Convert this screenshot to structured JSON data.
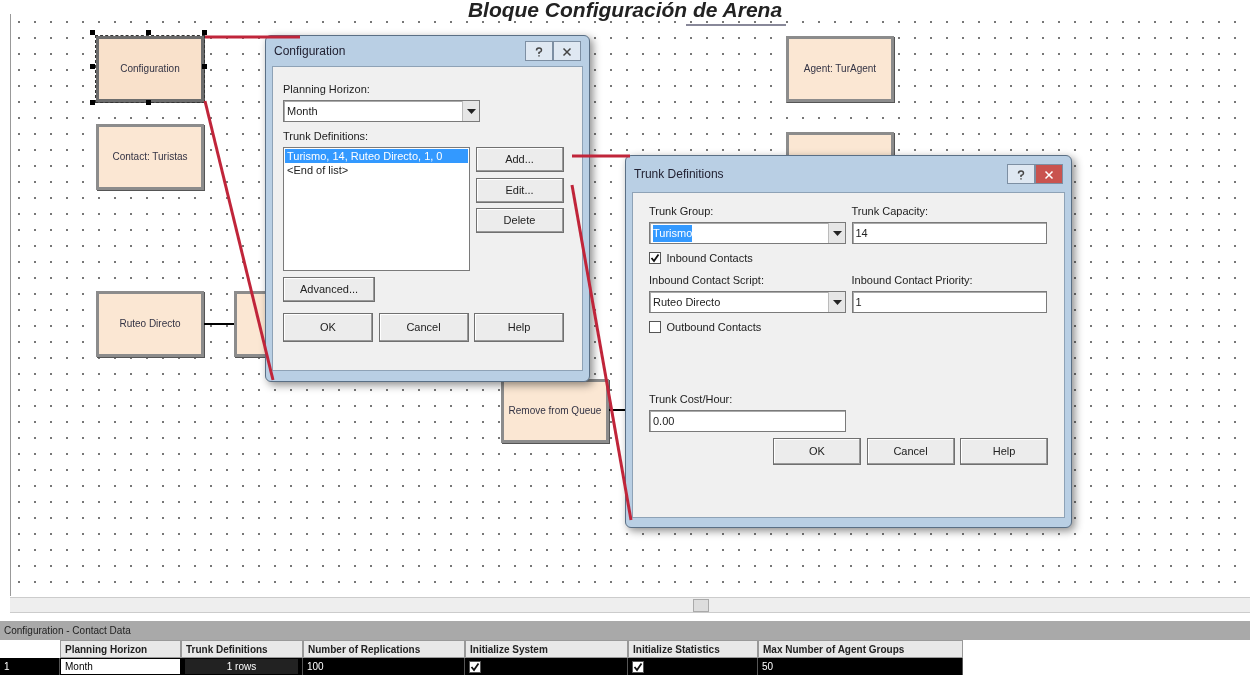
{
  "title": "Bloque Configuración de Arena",
  "modules": [
    {
      "label": "Configuration",
      "selected": true
    },
    {
      "label": "Contact: Turistas",
      "selected": false
    },
    {
      "label": "Ruteo Directo",
      "selected": false
    },
    {
      "label": "Agent: TurAgent",
      "selected": false
    },
    {
      "label": "Remove from Queue",
      "selected": false
    }
  ],
  "config_dialog": {
    "title": "Configuration",
    "planning_horizon_label": "Planning Horizon:",
    "planning_horizon": "Month",
    "trunk_definitions_label": "Trunk Definitions:",
    "trunk_definitions": [
      {
        "text": "Turismo, 14, Ruteo Directo, 1, 0",
        "selected": true
      },
      {
        "text": "<End of list>",
        "selected": false
      }
    ],
    "side_buttons": [
      "Add...",
      "Edit...",
      "Delete"
    ],
    "advanced_button": "Advanced...",
    "buttons": [
      "OK",
      "Cancel",
      "Help"
    ]
  },
  "trunk_dialog": {
    "title": "Trunk Definitions",
    "trunk_group_label": "Trunk Group:",
    "trunk_group": "Turismo",
    "trunk_capacity_label": "Trunk Capacity:",
    "trunk_capacity": "14",
    "inbound": {
      "label": "Inbound Contacts",
      "checked": true
    },
    "script_label": "Inbound Contact Script:",
    "script": "Ruteo Directo",
    "priority_label": "Inbound Contact Priority:",
    "priority": "1",
    "outbound": {
      "label": "Outbound Contacts",
      "checked": false
    },
    "cost_label": "Trunk Cost/Hour:",
    "cost": "0.00",
    "buttons": [
      "OK",
      "Cancel",
      "Help"
    ]
  },
  "spreadsheet": {
    "title": "Configuration - Contact Data",
    "columns": [
      "Planning Horizon",
      "Trunk Definitions",
      "Number of Replications",
      "Initialize System",
      "Initialize Statistics",
      "Max Number of Agent Groups"
    ],
    "rows": [
      {
        "number": "1",
        "cells": [
          {
            "kind": "text",
            "value": "Month"
          },
          {
            "kind": "button",
            "value": "1 rows"
          },
          {
            "kind": "text",
            "value": "100"
          },
          {
            "kind": "check",
            "checked": true
          },
          {
            "kind": "check",
            "checked": true
          },
          {
            "kind": "text",
            "value": "50"
          }
        ]
      }
    ]
  }
}
